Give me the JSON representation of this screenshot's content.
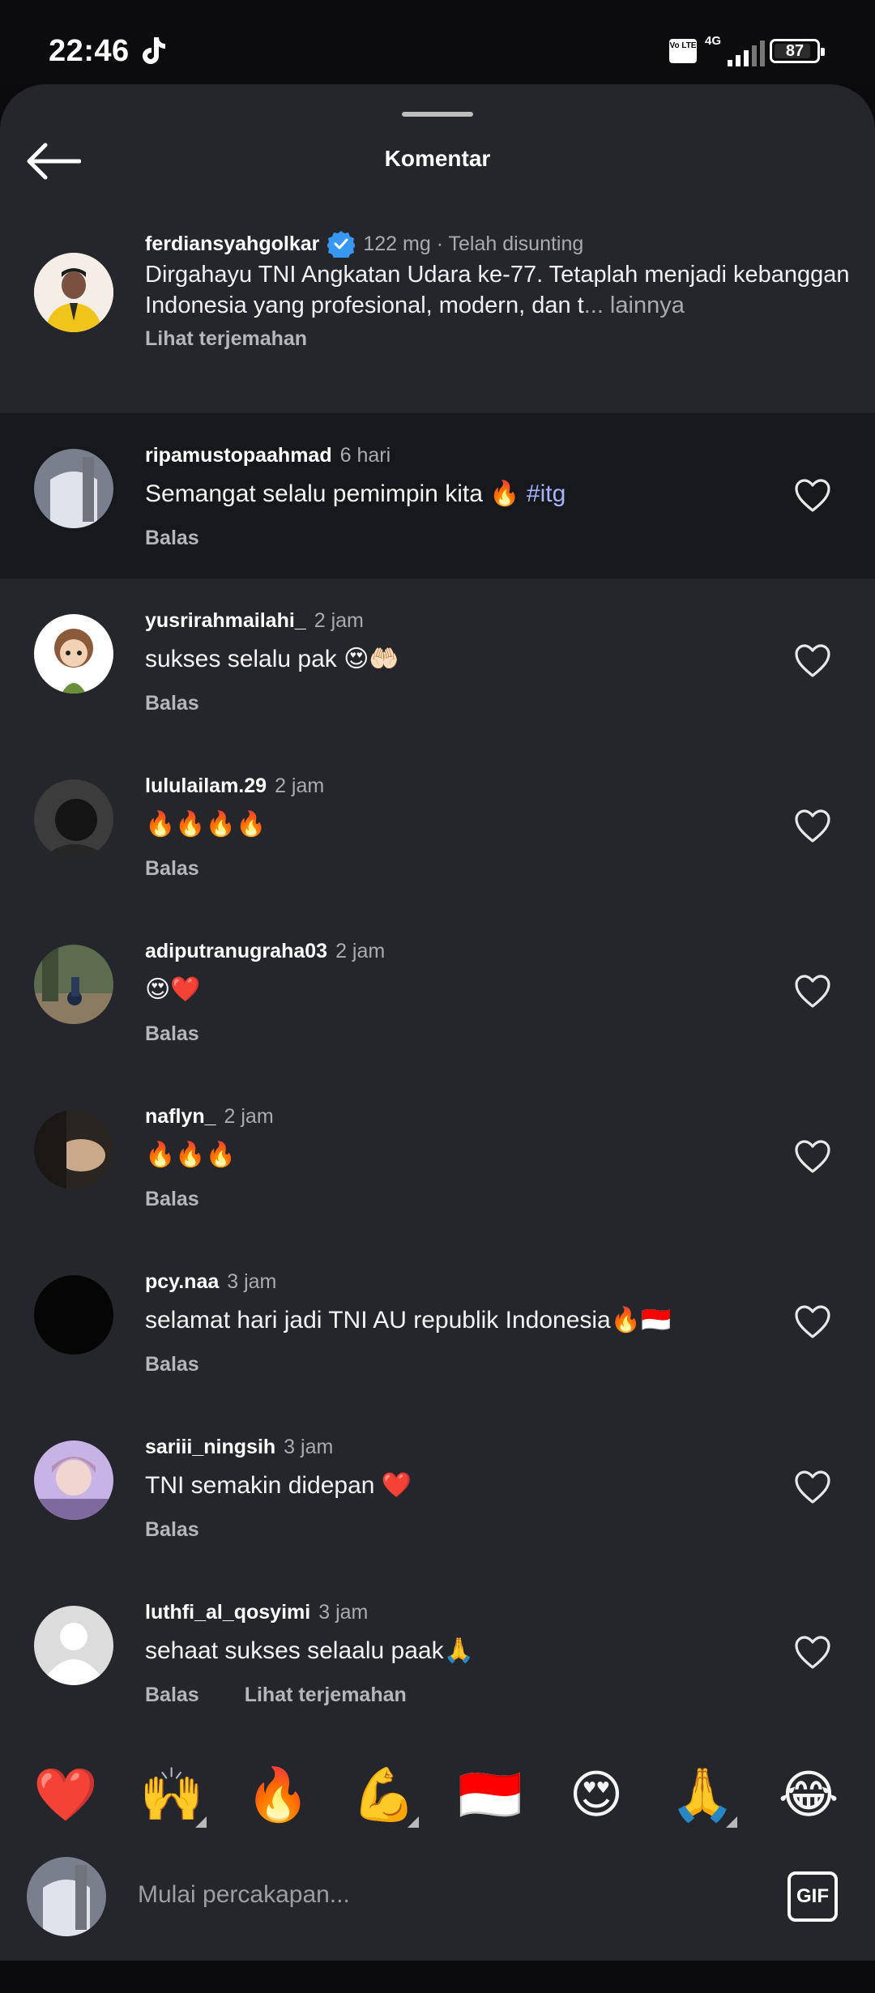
{
  "status_bar": {
    "time": "22:46",
    "network": "4G",
    "volte": "Vo LTE",
    "battery": "87"
  },
  "header": {
    "title": "Komentar"
  },
  "caption": {
    "username": "ferdiansyahgolkar",
    "meta": "122 mg · Telah disunting",
    "text": "Dirgahayu TNI Angkatan Udara ke-77. Tetaplah menjadi kebanggan Indonesia yang profesional, modern, dan t",
    "more": "... lainnya",
    "translate": "Lihat terjemahan"
  },
  "comments": [
    {
      "username": "ripamustopaahmad",
      "time": "6 hari",
      "text": "Semangat selalu pemimpin kita 🔥 ",
      "hashtag": "#itg",
      "reply": "Balas",
      "translate": ""
    },
    {
      "username": "yusrirahmailahi_",
      "time": "2 jam",
      "text": "sukses selalu pak 😍🤲🏻",
      "hashtag": "",
      "reply": "Balas",
      "translate": ""
    },
    {
      "username": "lululailam.29",
      "time": "2 jam",
      "text": "🔥🔥🔥🔥",
      "hashtag": "",
      "reply": "Balas",
      "translate": ""
    },
    {
      "username": "adiputranugraha03",
      "time": "2 jam",
      "text": "😍❤️",
      "hashtag": "",
      "reply": "Balas",
      "translate": ""
    },
    {
      "username": "naflyn_",
      "time": "2 jam",
      "text": "🔥🔥🔥",
      "hashtag": "",
      "reply": "Balas",
      "translate": ""
    },
    {
      "username": "pcy.naa",
      "time": "3 jam",
      "text": "selamat hari jadi TNI AU republik Indonesia🔥🇮🇩",
      "hashtag": "",
      "reply": "Balas",
      "translate": ""
    },
    {
      "username": "sariii_ningsih",
      "time": "3 jam",
      "text": "TNI semakin didepan ❤️",
      "hashtag": "",
      "reply": "Balas",
      "translate": ""
    },
    {
      "username": "luthfi_al_qosyimi",
      "time": "3 jam",
      "text": "sehaat sukses selaalu paak🙏",
      "hashtag": "",
      "reply": "Balas",
      "translate": "Lihat terjemahan"
    }
  ],
  "emoji_bar": [
    "❤️",
    "🙌",
    "🔥",
    "💪",
    "🇮🇩",
    "😍",
    "🙏",
    "😂"
  ],
  "input": {
    "placeholder": "Mulai percakapan...",
    "gif_label": "GIF"
  },
  "colors": {
    "sheet_bg": "#24262b",
    "highlight_bg": "#17181b",
    "muted_text": "#a9abb0",
    "hashtag": "#a6b3ff",
    "verified": "#3897f0"
  }
}
